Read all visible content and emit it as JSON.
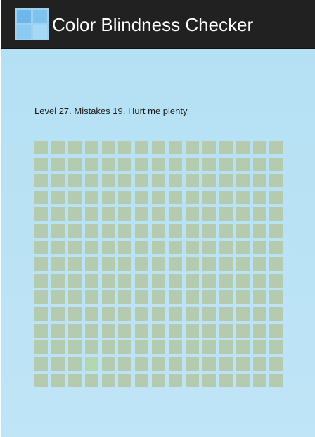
{
  "app": {
    "title": "Color Blindness Checker",
    "icon": "app-grid-icon"
  },
  "status": {
    "text": "Level 27. Mistakes 19. Hurt me plenty"
  },
  "board": {
    "rows": 15,
    "columns": 15,
    "tile_color": "#b4cbb0",
    "odd_tile_color": "#b2d8b0",
    "odd_tile": {
      "row": 14,
      "column": 4
    }
  },
  "colors": {
    "action_bar": "#212121",
    "background": "#b8e2f5"
  }
}
